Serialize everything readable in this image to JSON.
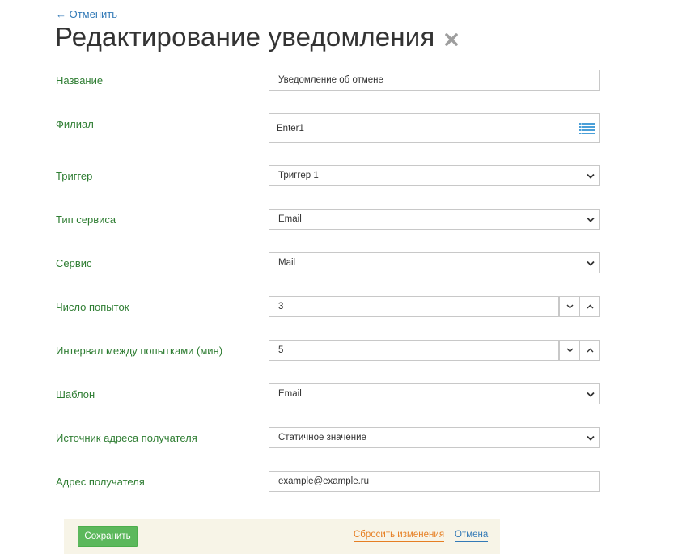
{
  "header": {
    "back_label": "← Отменить",
    "title": "Редактирование уведомления"
  },
  "form": {
    "name": {
      "label": "Название",
      "value": "Уведомление об отмене"
    },
    "branch": {
      "label": "Филиал",
      "value": "Enter1"
    },
    "trigger": {
      "label": "Триггер",
      "value": "Триггер 1"
    },
    "service_type": {
      "label": "Тип сервиса",
      "value": "Email"
    },
    "service": {
      "label": "Сервис",
      "value": "Mail"
    },
    "attempts": {
      "label": "Число попыток",
      "value": "3"
    },
    "interval": {
      "label": "Интервал между попытками (мин)",
      "value": "5"
    },
    "template": {
      "label": "Шаблон",
      "value": "Email"
    },
    "recipient_source": {
      "label": "Источник адреса получателя",
      "value": "Статичное значение"
    },
    "recipient_address": {
      "label": "Адрес получателя",
      "value": "example@example.ru"
    }
  },
  "footer": {
    "save_label": "Сохранить",
    "reset_label": "Сбросить изменения",
    "cancel_label": "Отмена"
  },
  "colors": {
    "label_green": "#2e7d32",
    "link_blue": "#337ab7",
    "save_green": "#5cb85c",
    "reset_orange": "#e67e22",
    "footer_bg": "#f7f4e7"
  },
  "icons": {
    "close": "close-x-icon",
    "branch_list": "list-icon",
    "select_caret": "chevron-down-icon",
    "stepper_down": "chevron-down-icon",
    "stepper_up": "chevron-up-icon"
  }
}
